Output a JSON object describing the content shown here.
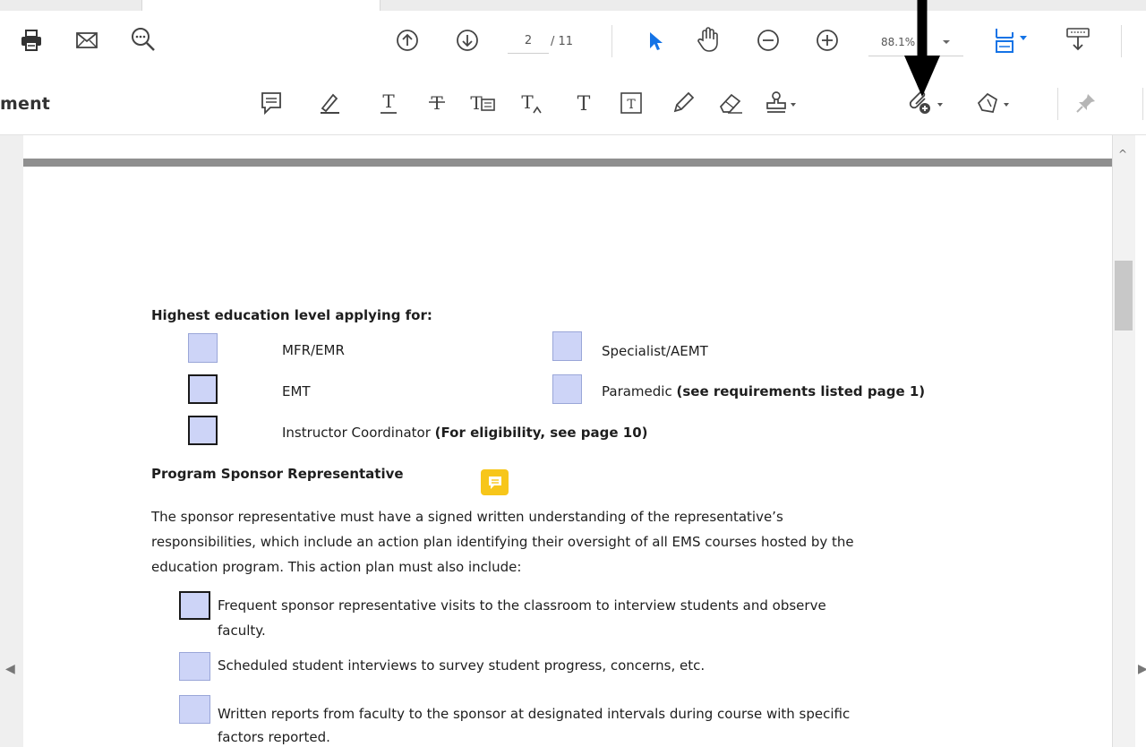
{
  "toolbar": {
    "page_current": "2",
    "page_total": "/ 11",
    "zoom": "88.1%"
  },
  "comment_toolbar": {
    "label": "ment"
  },
  "document": {
    "education_heading": "Highest education level applying for",
    "education_heading_colon": ":",
    "options": {
      "mfr": "MFR/EMR",
      "specialist": "Specialist/AEMT",
      "emt": "EMT",
      "paramedic": "Paramedic",
      "paramedic_note": "(see requirements listed page 1)",
      "instructor": "Instructor Coordinator",
      "instructor_note": "(For eligibility, see page 10)"
    },
    "sponsor_heading": "Program Sponsor Representative",
    "paragraph_lines": [
      "The sponsor representative must have a signed written understanding of the representative’s",
      "responsibilities, which include an action plan identifying their oversight of all EMS courses hosted by the",
      "education program.  This action plan must also include:"
    ],
    "checklist": [
      [
        "Frequent sponsor representative visits to the classroom to interview students and observe",
        "faculty."
      ],
      [
        "Scheduled student interviews to survey student progress, concerns, etc."
      ],
      [
        "Written reports from faculty to the sponsor at designated intervals during course with specific",
        "factors reported."
      ]
    ]
  },
  "colors": {
    "checkbox_fill": "#cdd4f7",
    "accent_blue": "#1473e6",
    "note_yellow": "#f7c61a"
  }
}
